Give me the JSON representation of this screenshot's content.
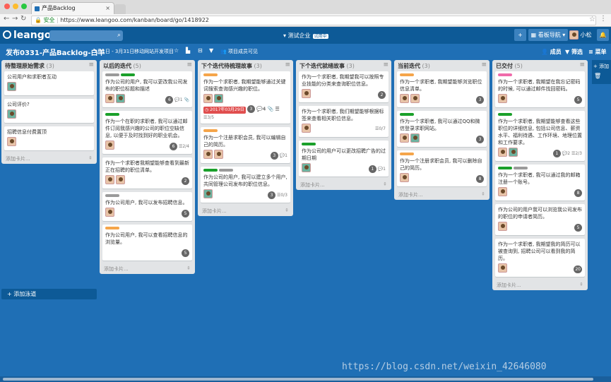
{
  "browser": {
    "tab_title": "产品Backlog",
    "secure_label": "安全",
    "url": "https://www.leangoo.com/kanban/board/go/1418922"
  },
  "app": {
    "logo_text": "leangoo",
    "org_label": "测试企业",
    "org_badge": "试用中",
    "board_nav_label": "看板导航",
    "user_name": "小松"
  },
  "board": {
    "title": "发布0331-产品Backlog-白羊",
    "date_range": "1月1日 - 3月31日",
    "subtitle": "移动网站开发项目",
    "members_visible": "项目成员可见",
    "actions": [
      "成员",
      "筛选",
      "菜单"
    ]
  },
  "add_card_label": "添加卡片...",
  "add_swimlane_label": "添加泳道",
  "add_column_label": "添加",
  "lists": [
    {
      "title": "待整理原始需求",
      "count": "(3)",
      "cards": [
        {
          "text": "公司用户和求职者互动"
        },
        {
          "text": "公司评价?"
        },
        {
          "text": "招聘信息付费置顶"
        }
      ]
    },
    {
      "title": "以后的迭代",
      "count": "(5)",
      "cards": [
        {
          "text": "作为公司的用户, 我可以更改我公司发布的职位标题和描述",
          "num": "6",
          "meta": "1"
        },
        {
          "text": "作为一个在职的求职者, 我可以通过邮件订阅我感兴趣的公司的职位空缺信息, 以便于及时找到好的职业机会。",
          "num": "6",
          "meta": "2/4"
        },
        {
          "text": "作为一个求职者我期望能够查看到最新正在招聘的职位清单。",
          "num": "2"
        },
        {
          "text": "作为公司用户, 我可以发布招聘信息。",
          "num": "5"
        },
        {
          "text": "作为公司用户, 我可以查看招聘信息的浏览量。",
          "num": "5"
        }
      ]
    },
    {
      "title": "下个迭代待梳理故事",
      "count": "(3)",
      "cards": [
        {
          "text": "作为一个求职者, 我期望能够通过关键词搜索查询感兴趣的职位。",
          "due": "2017年03月29日",
          "num": "3",
          "meta": "4",
          "meta2": "3/5"
        },
        {
          "text": "作为一个注册求职会员, 我可以编辑自己的简历。",
          "num": "3",
          "meta": "1"
        },
        {
          "text": "作为公司的用户, 我可以建立多个用户, 共同管理公司发布的职位信息。",
          "num": "3",
          "meta": "0/3"
        }
      ]
    },
    {
      "title": "下个迭代就绪故事",
      "count": "(3)",
      "cards": [
        {
          "text": "作为一个求职者, 我期望我可以按照专业技能的分类来查询职位信息。",
          "num": "2"
        },
        {
          "text": "作为一个求职者, 我们期望能够根据标签来查看相关职位信息。",
          "meta": "0/7"
        },
        {
          "text": "作为公司的用户可以更改招聘广告的过期日期",
          "num": "1",
          "meta": "1"
        }
      ]
    },
    {
      "title": "当前迭代",
      "count": "(3)",
      "cards": [
        {
          "text": "作为一个求职者, 我期望能够浏览职位信息清单。",
          "num": "3"
        },
        {
          "text": "作为一个求职者, 我可以通过QQ和微信登录求职网站。",
          "num": "3"
        },
        {
          "text": "作为一个注册求职会员, 我可以删除自己的简历。",
          "num": "8"
        }
      ]
    },
    {
      "title": "已交付",
      "count": "(5)",
      "cards": [
        {
          "text": "作为一个求职者, 我期望在我忘记密码的时候, 可以通过邮件找回密码。",
          "num": "5"
        },
        {
          "text": "作为一个求职者, 我期望能够查看这些职位的详细信息, 包括公司信息、薪资水平、福利待遇、工作环境、地理位置和工作要求。",
          "num": "1",
          "meta": "2",
          "meta2": "2/3"
        },
        {
          "text": "作为一个求职者, 我可以通过我的邮箱注册一个账号。",
          "num": "8"
        },
        {
          "text": "作为公司的用户我可以浏览我公司发布的职位的申请者简历。",
          "num": "5"
        },
        {
          "text": "作为一个求职者, 我期望我的简历可以被查询到, 招聘公司可以看到我的简历。",
          "num": "20"
        }
      ]
    }
  ],
  "watermark": "https://blog.csdn.net/weixin_42646080",
  "colors": {
    "board": "#1f6fb5",
    "topbar": "#0d5a97",
    "green": "#1aa02a",
    "orange": "#f5a54a",
    "pink": "#f06aaa",
    "gray": "#9a9a9a",
    "red_due": "#e04e4e"
  }
}
